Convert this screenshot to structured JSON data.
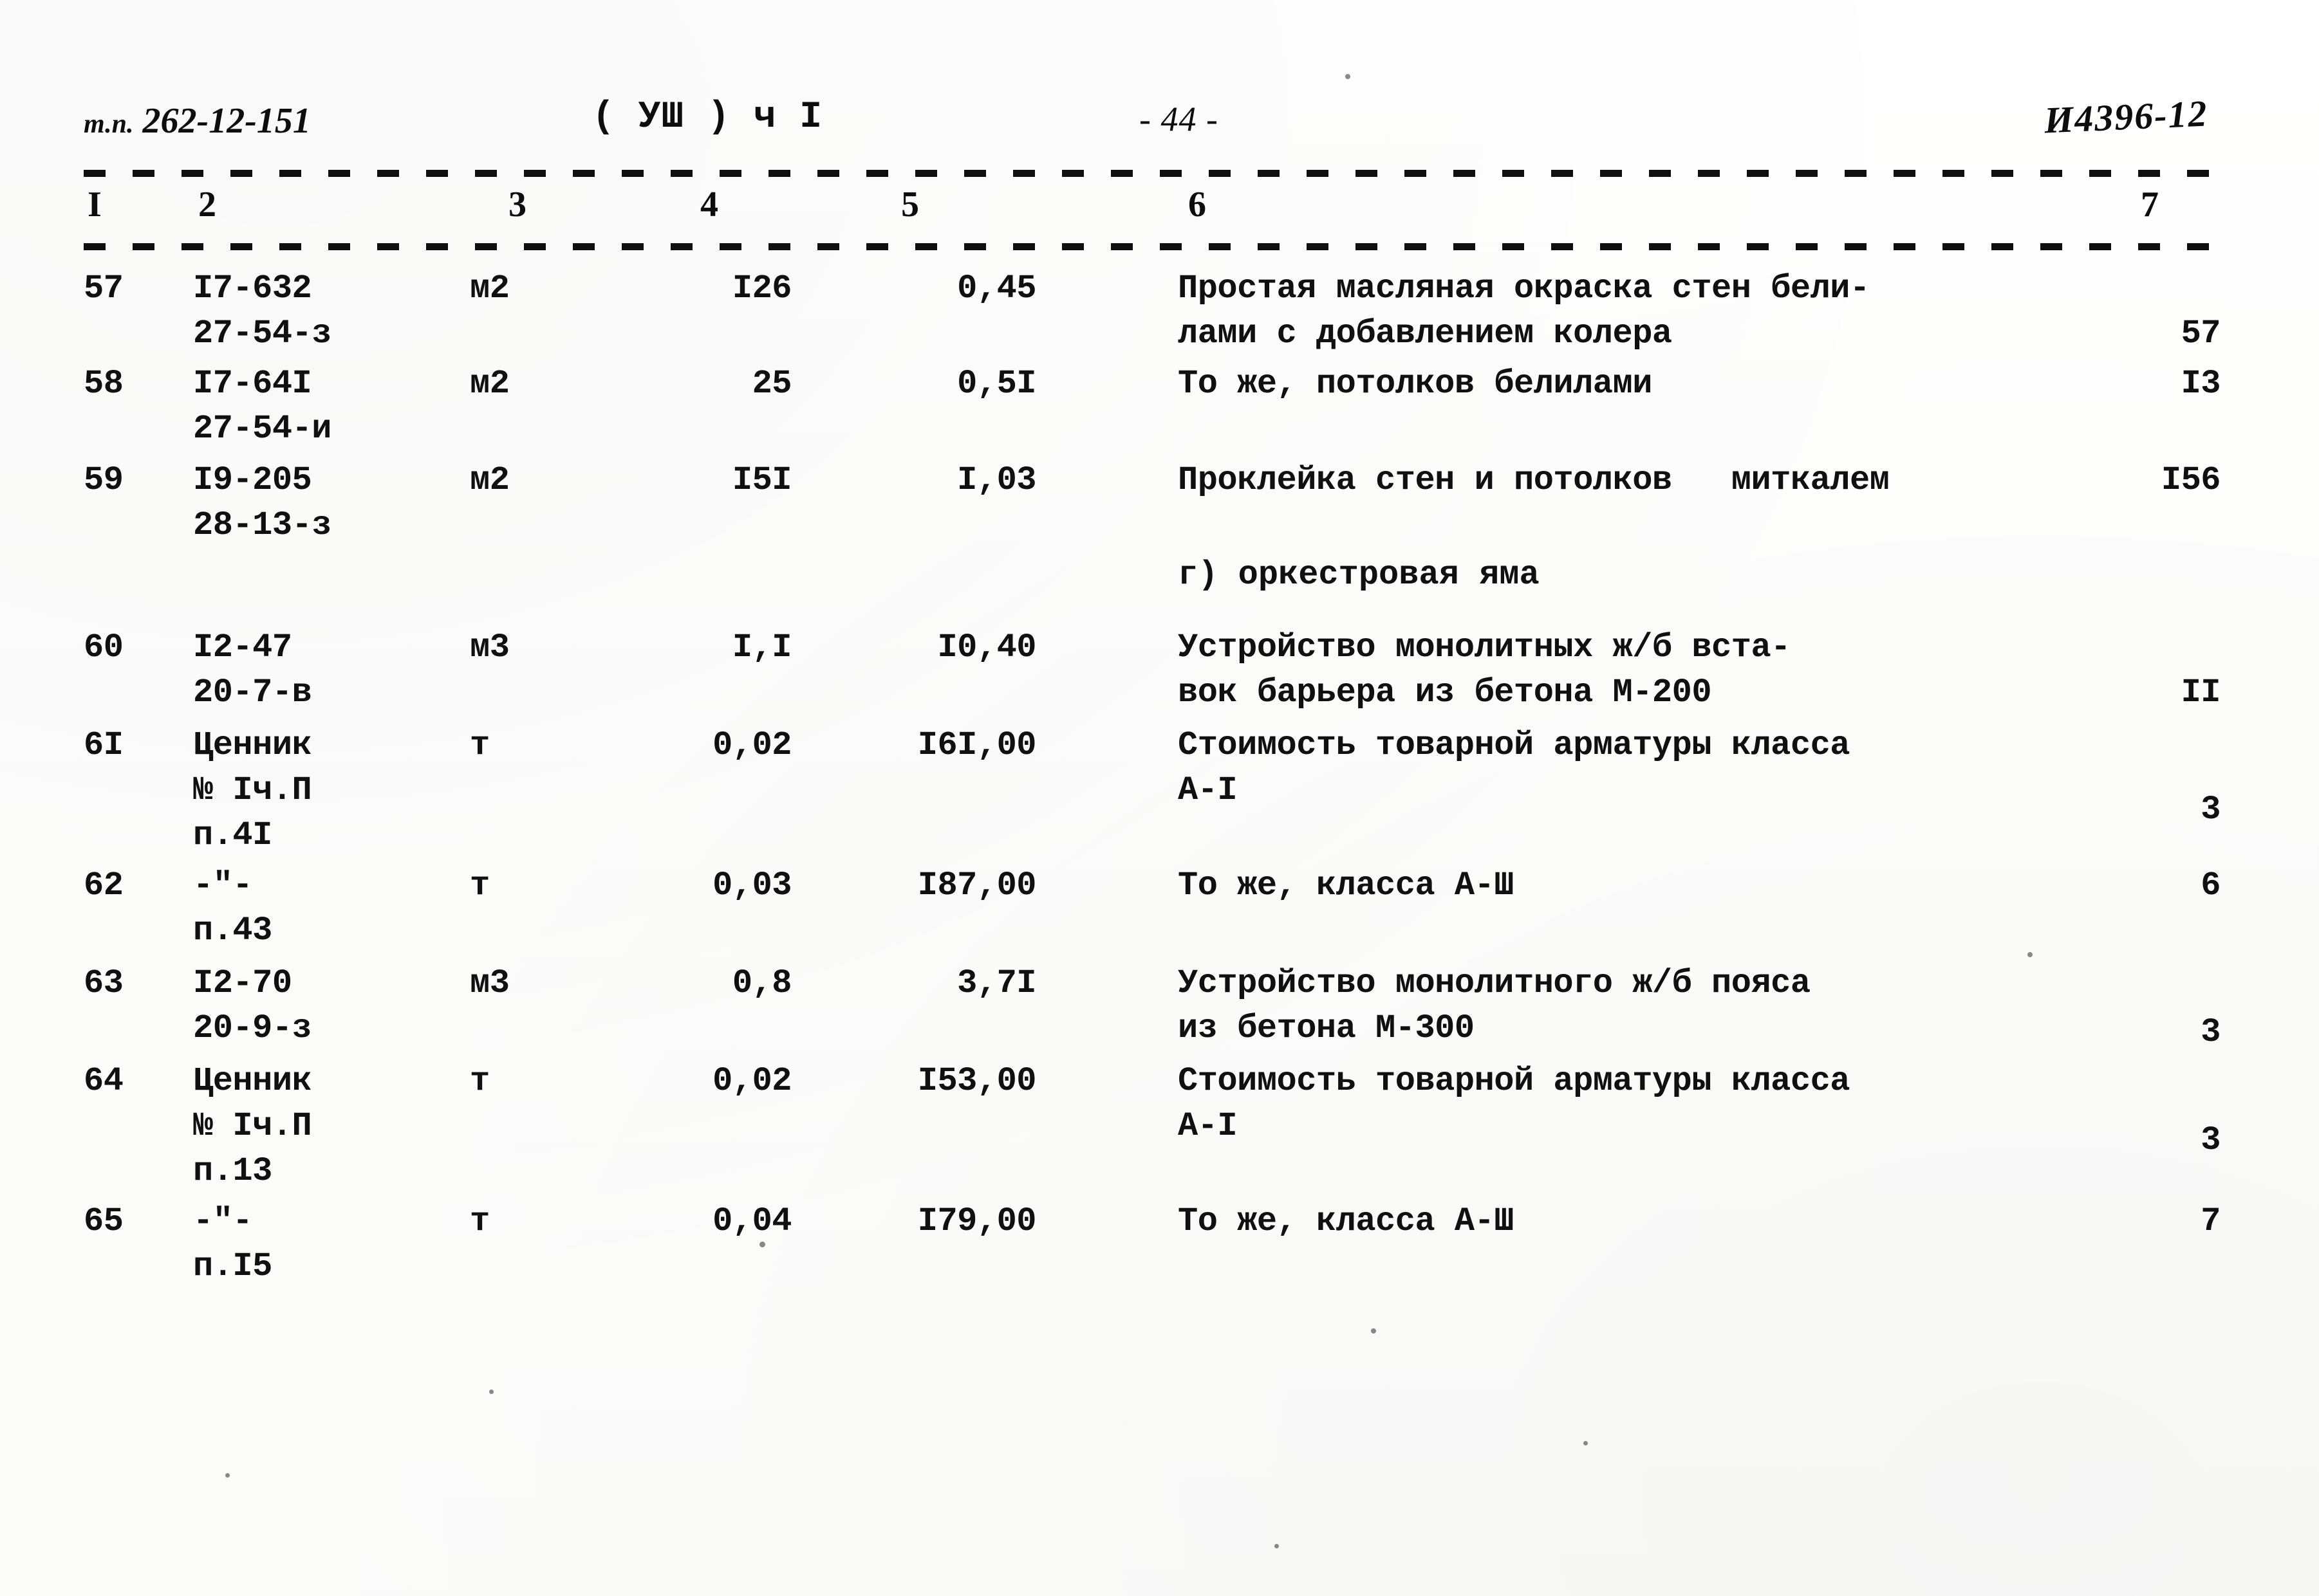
{
  "header": {
    "doc_prefix": "т.п.",
    "doc_number": "262-12-151",
    "part": "( УШ ) ч I",
    "page_marker": "- 44 -",
    "archive_code": "И4396-12"
  },
  "table": {
    "column_numbers": [
      "I",
      "2",
      "3",
      "4",
      "5",
      "6",
      "7"
    ],
    "rows": [
      {
        "num": "57",
        "code_line1": "I7-632",
        "code_line2": "27-54-з",
        "unit": "м2",
        "quantity": "I26",
        "price": "0,45",
        "desc_line1": "Простая масляная окраска стен бели-",
        "desc_line2": "лами с добавлением колера",
        "total": "57"
      },
      {
        "num": "58",
        "code_line1": "I7-64I",
        "code_line2": "27-54-и",
        "unit": "м2",
        "quantity": "25",
        "price": "0,5I",
        "desc_line1": "То же, потолков белилами",
        "desc_line2": "",
        "total": "I3"
      },
      {
        "num": "59",
        "code_line1": "I9-205",
        "code_line2": "28-13-з",
        "unit": "м2",
        "quantity": "I5I",
        "price": "I,03",
        "desc_line1": "Проклейка стен и потолков   миткалем",
        "desc_line2": "",
        "total": "I56"
      },
      {
        "num": "60",
        "code_line1": "I2-47",
        "code_line2": "20-7-в",
        "unit": "м3",
        "quantity": "I,I",
        "price": "I0,40",
        "desc_line1": "Устройство монолитных ж/б вста-",
        "desc_line2": "вок барьера из бетона М-200",
        "total": "II"
      },
      {
        "num": "6I",
        "code_line1": "Ценник",
        "code_line2": "№ Iч.П",
        "code_line3": "п.4I",
        "unit": "т",
        "quantity": "0,02",
        "price": "I6I,00",
        "desc_line1": "Стоимость товарной арматуры класса",
        "desc_line2": "А-I",
        "total": "3"
      },
      {
        "num": "62",
        "code_line1": "-\"-",
        "code_line2": "п.43",
        "unit": "т",
        "quantity": "0,03",
        "price": "I87,00",
        "desc_line1": "То же, класса А-Ш",
        "desc_line2": "",
        "total": "6"
      },
      {
        "num": "63",
        "code_line1": "I2-70",
        "code_line2": "20-9-з",
        "unit": "м3",
        "quantity": "0,8",
        "price": "3,7I",
        "desc_line1": "Устройство монолитного ж/б пояса",
        "desc_line2": "из бетона М-300",
        "total": "3"
      },
      {
        "num": "64",
        "code_line1": "Ценник",
        "code_line2": "№ Iч.П",
        "code_line3": "п.13",
        "unit": "т",
        "quantity": "0,02",
        "price": "I53,00",
        "desc_line1": "Стоимость товарной арматуры класса",
        "desc_line2": "А-I",
        "total": "3"
      },
      {
        "num": "65",
        "code_line1": "-\"-",
        "code_line2": "п.I5",
        "unit": "т",
        "quantity": "0,04",
        "price": "I79,00",
        "desc_line1": "То же, класса А-Ш",
        "desc_line2": "",
        "total": "7"
      }
    ],
    "section_heading": "г) оркестровая яма"
  }
}
